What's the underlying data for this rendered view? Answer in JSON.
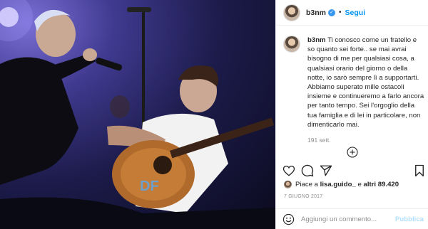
{
  "post": {
    "username": "b3nm",
    "verified_mark": "✓",
    "separator": "•",
    "follow_label": "Segui",
    "caption": {
      "username": "b3nm",
      "text": "Ti conosco come un fratello e so quanto sei forte.. se mai avrai bisogno di me per qualsiasi cosa, a qualsiasi orario del giorno o della notte, io sarò sempre lì a supportarti. Abbiamo superato mille ostacoli insieme e continueremo a farlo ancora per tanto tempo. Sei l'orgoglio della tua famiglia e di lei in particolare, non dimenticarlo mai.",
      "time": "191 sett."
    },
    "likes": {
      "prefix": "Piace a",
      "user": "lisa.guido_",
      "middle": "e",
      "others": "altri 89.420"
    },
    "date": "7 GIUGNO 2017",
    "comment": {
      "placeholder": "Aggiungi un commento...",
      "publish_label": "Pubblica"
    },
    "colors": {
      "accent": "#0095f6",
      "verified": "#3897f0",
      "publish_disabled": "#b2dffc",
      "muted": "#8e8e8e"
    },
    "icons": [
      "heart-icon",
      "comment-icon",
      "share-icon",
      "bookmark-icon",
      "emoji-icon",
      "load-more-icon"
    ]
  }
}
